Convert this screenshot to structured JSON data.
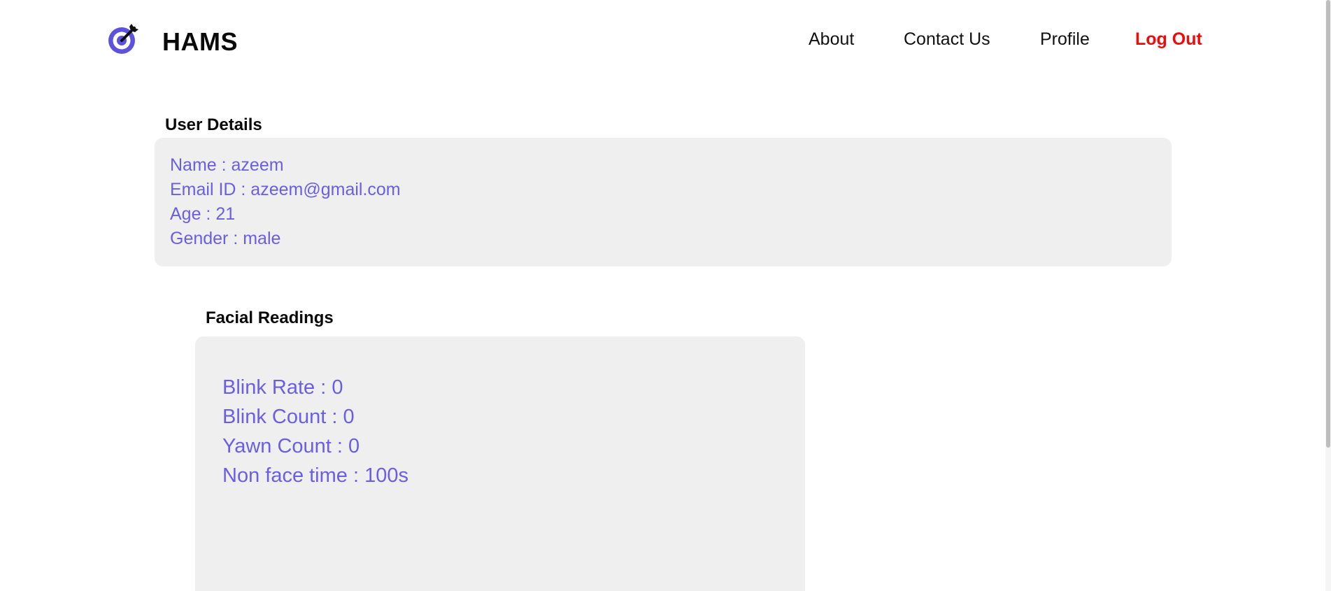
{
  "header": {
    "brand": "HAMS",
    "logo_icon": "target-dart-icon",
    "nav": {
      "about": "About",
      "contact": "Contact Us",
      "profile": "Profile",
      "logout": "Log Out"
    }
  },
  "user_details": {
    "title": "User Details",
    "lines": [
      "Name : azeem",
      "Email ID : azeem@gmail.com",
      "Age : 21",
      "Gender : male"
    ]
  },
  "facial_readings": {
    "title": "Facial Readings",
    "lines": [
      "Blink Rate : 0",
      "Blink Count : 0",
      "Yawn Count : 0",
      "Non face time : 100s"
    ]
  },
  "colors": {
    "accent": "#6a5ee6",
    "logout": "#f00a0a",
    "panel_bg": "#efefef"
  }
}
